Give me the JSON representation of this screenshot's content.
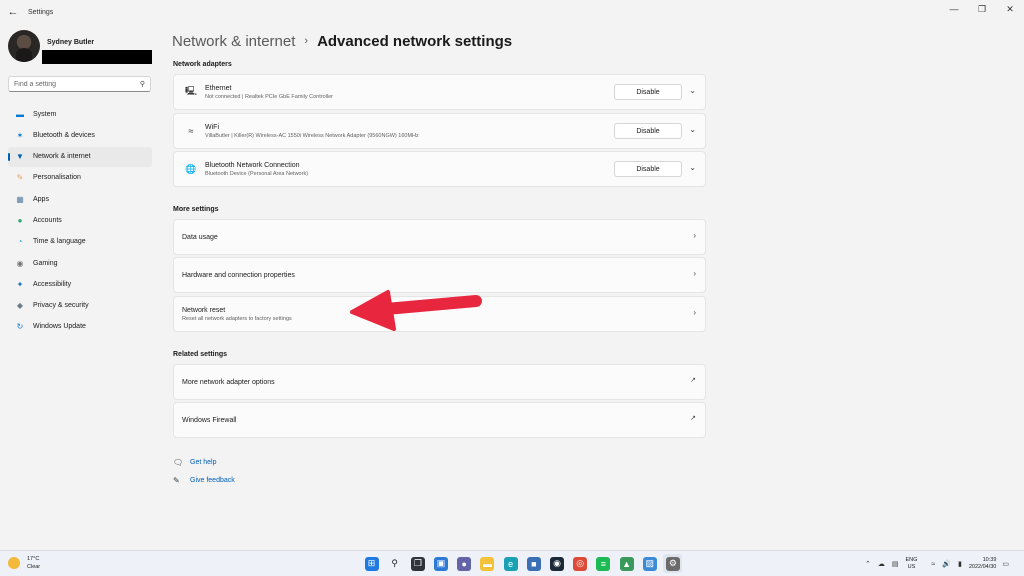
{
  "app": {
    "title": "Settings"
  },
  "profile": {
    "name": "Sydney Butler"
  },
  "search": {
    "placeholder": "Find a setting"
  },
  "nav": [
    {
      "label": "System",
      "icon": "monitor-icon",
      "color": "#0078d4"
    },
    {
      "label": "Bluetooth & devices",
      "icon": "bluetooth-icon",
      "color": "#0078d4"
    },
    {
      "label": "Network & internet",
      "icon": "wifi-icon",
      "color": "#0063b1",
      "active": true
    },
    {
      "label": "Personalisation",
      "icon": "brush-icon",
      "color": "#e8a04a"
    },
    {
      "label": "Apps",
      "icon": "apps-icon",
      "color": "#5b7fa6"
    },
    {
      "label": "Accounts",
      "icon": "person-icon",
      "color": "#2ea66b"
    },
    {
      "label": "Time & language",
      "icon": "globe-clock-icon",
      "color": "#2aa5d6"
    },
    {
      "label": "Gaming",
      "icon": "gamepad-icon",
      "color": "#767676"
    },
    {
      "label": "Accessibility",
      "icon": "accessibility-icon",
      "color": "#1a6fc0"
    },
    {
      "label": "Privacy & security",
      "icon": "shield-icon",
      "color": "#6e7c8c"
    },
    {
      "label": "Windows Update",
      "icon": "update-icon",
      "color": "#0a78d7"
    }
  ],
  "breadcrumb": {
    "parent": "Network & internet",
    "separator": "›",
    "current": "Advanced network settings"
  },
  "network_adapters": {
    "section_title": "Network adapters",
    "button_label": "Disable",
    "items": [
      {
        "name": "Ethernet",
        "detail": "Not connected | Realtek PCIe GbE Family Controller",
        "icon": "ethernet-icon"
      },
      {
        "name": "WiFi",
        "detail": "VillaButler | Killer(R) Wireless-AC 1550i Wireless Network Adapter (9560NGW) 160MHz",
        "icon": "wifi-icon"
      },
      {
        "name": "Bluetooth Network Connection",
        "detail": "Bluetooth Device (Personal Area Network)",
        "icon": "network-globe-icon"
      }
    ]
  },
  "more_settings": {
    "section_title": "More settings",
    "items": [
      {
        "title": "Data usage",
        "subtitle": ""
      },
      {
        "title": "Hardware and connection properties",
        "subtitle": ""
      },
      {
        "title": "Network reset",
        "subtitle": "Reset all network adapters to factory settings"
      }
    ]
  },
  "related_settings": {
    "section_title": "Related settings",
    "items": [
      {
        "title": "More network adapter options"
      },
      {
        "title": "Windows Firewall"
      }
    ]
  },
  "help": {
    "get_help": "Get help",
    "give_feedback": "Give feedback"
  },
  "annotation": {
    "arrow_color": "#e8273f"
  },
  "taskbar": {
    "weather_temp": "17°C",
    "weather_desc": "Clear",
    "apps": [
      "windows-start-icon",
      "search-icon",
      "task-view-icon",
      "widgets-icon",
      "chat-icon",
      "file-explorer-icon",
      "edge-icon",
      "store-icon",
      "steam-icon",
      "chrome-icon",
      "spotify-icon",
      "app-icon",
      "photos-icon",
      "settings-icon"
    ],
    "lang_top": "ENG",
    "lang_bottom": "US",
    "time": "10:39",
    "date": "2022/04/30"
  }
}
